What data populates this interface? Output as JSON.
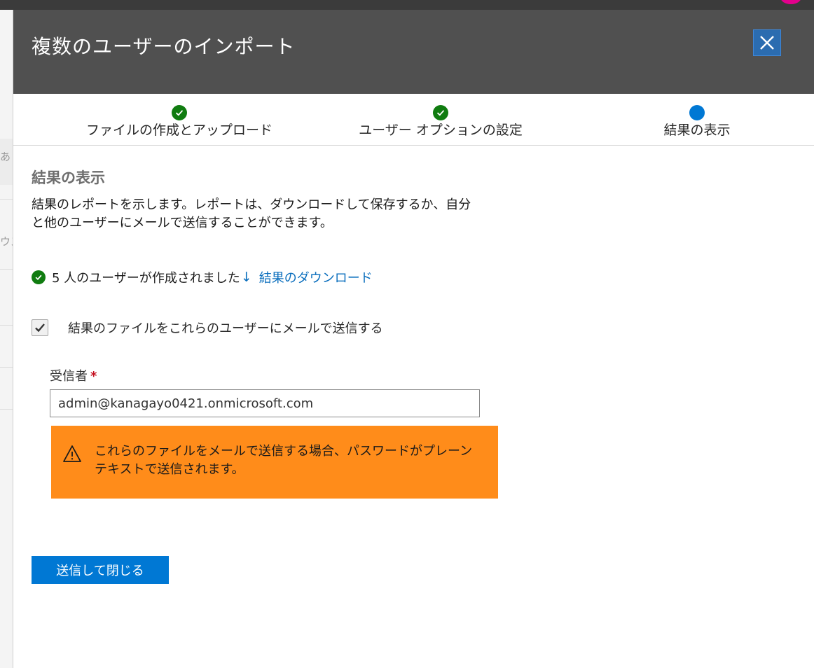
{
  "background": {
    "left_fragments": [
      "あ",
      "ウス"
    ]
  },
  "panel": {
    "title": "複数のユーザーのインポート",
    "close_icon": "close-icon"
  },
  "steps": [
    {
      "label": "ファイルの作成とアップロード",
      "state": "done"
    },
    {
      "label": "ユーザー オプションの設定",
      "state": "done"
    },
    {
      "label": "結果の表示",
      "state": "current"
    }
  ],
  "content": {
    "section_title": "結果の表示",
    "description": "結果のレポートを示します。レポートは、ダウンロードして保存するか、自分と他のユーザーにメールで送信することができます。",
    "result_text": "5 人のユーザーが作成されました",
    "download_link": "結果のダウンロード",
    "send_checkbox_label": "結果のファイルをこれらのユーザーにメールで送信する",
    "send_checkbox_checked": true,
    "recipient_label": "受信者",
    "required_mark": "*",
    "recipient_value": "admin@kanagayo0421.onmicrosoft.com",
    "warning_text": "これらのファイルをメールで送信する場合、パスワードがプレーンテキストで送信されます。",
    "submit_button": "送信して閉じる"
  },
  "colors": {
    "header_bg": "#505050",
    "accent": "#0078d4",
    "success": "#107c10",
    "warning": "#ff8c1a",
    "link": "#0a6ebd"
  }
}
